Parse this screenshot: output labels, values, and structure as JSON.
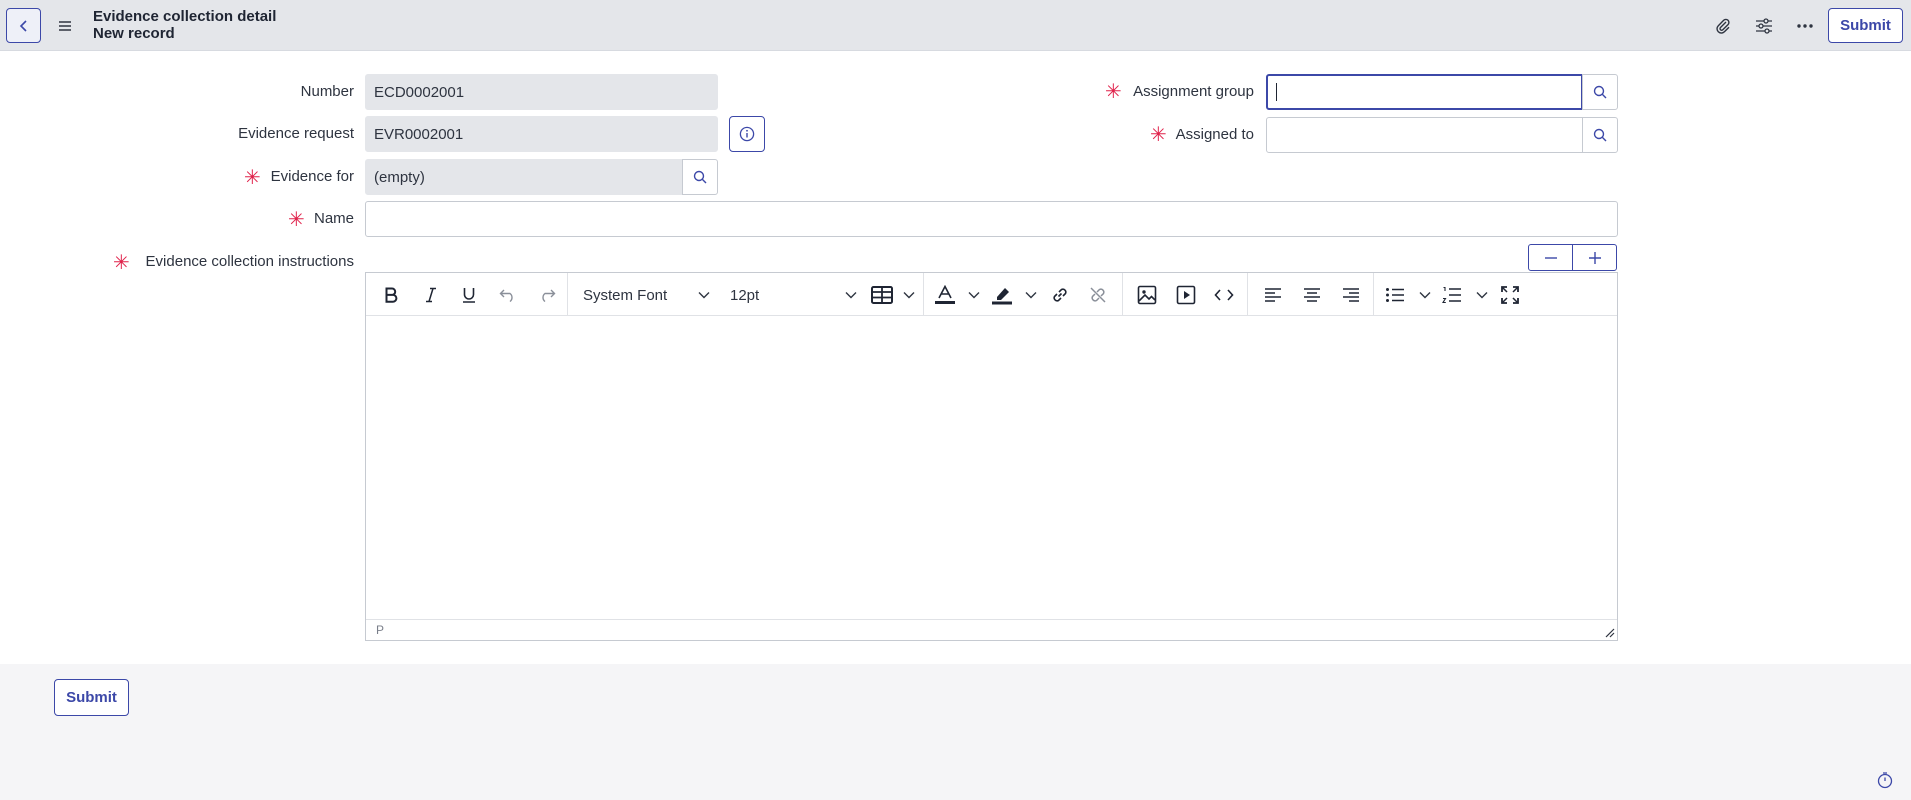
{
  "header": {
    "title": "Evidence collection detail",
    "subtitle": "New record",
    "submit_label": "Submit"
  },
  "form": {
    "number": {
      "label": "Number",
      "value": "ECD0002001"
    },
    "evidence_request": {
      "label": "Evidence request",
      "value": "EVR0002001"
    },
    "evidence_for": {
      "label": "Evidence for",
      "value": "(empty)",
      "required": true
    },
    "name": {
      "label": "Name",
      "value": "",
      "required": true
    },
    "instructions": {
      "label": "Evidence collection instructions",
      "required": true
    },
    "assignment_group": {
      "label": "Assignment group",
      "value": "",
      "required": true
    },
    "assigned_to": {
      "label": "Assigned to",
      "value": "",
      "required": true
    }
  },
  "editor": {
    "font_family": "System Font",
    "font_size": "12pt",
    "status_path": "P"
  },
  "footer": {
    "submit_label": "Submit"
  },
  "colors": {
    "accent": "#3c48a8",
    "required": "#e0224b",
    "header_bg": "#e4e6ea"
  }
}
